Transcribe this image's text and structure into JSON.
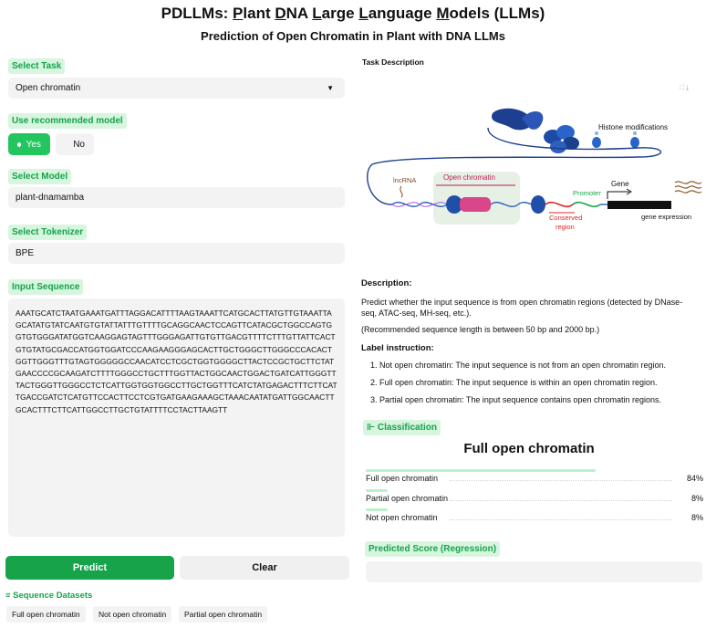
{
  "header": {
    "title_parts": [
      {
        "t": "PDLLMs: ",
        "u": false
      },
      {
        "t": "P",
        "u": true
      },
      {
        "t": "lant ",
        "u": false
      },
      {
        "t": "D",
        "u": true
      },
      {
        "t": "NA ",
        "u": false
      },
      {
        "t": "L",
        "u": true
      },
      {
        "t": "arge ",
        "u": false
      },
      {
        "t": "L",
        "u": true
      },
      {
        "t": "anguage ",
        "u": false
      },
      {
        "t": "M",
        "u": true
      },
      {
        "t": "odels (LLMs)",
        "u": false
      }
    ],
    "subtitle": "Prediction of Open Chromatin in Plant with DNA LLMs"
  },
  "left": {
    "task_label": "Select Task",
    "task_value": "Open chromatin",
    "recommended_label": "Use recommended model",
    "yes_label": "Yes",
    "no_label": "No",
    "model_label": "Select Model",
    "model_value": "plant-dnamamba",
    "tokenizer_label": "Select Tokenizer",
    "tokenizer_value": "BPE",
    "input_label": "Input Sequence",
    "sequence": "AAATGCATCTAATGAAATGATTTAGGACATTTTAAGTAAATTCATGCACTTATGTTGTAAATTAGCATATGTATCAATGTGTATTATTTGTTTTGCAGGCAACTCCAGTTCATACGCTGGCCAGTGGTGTGGGATATGGTCAAGGAGTAGTTTGGGAGATTGTGTTGACGTTTTCTTTGTTATTCACTGTGTATGCGACCATGGTGGATCCCAAGAAGGGAGCACTTGCTGGGCTTGGGCCCACACTGGTTGGGTTTGTAGTGGGGGCCAACATCCTCGCTGGTGGGGCTTACTCCGCTGCTTCTATGAACCCCGCAAGATCTTTTGGGCCTGCTTTGGTTACTGGCAACTGGACTGATCATTGGGTTTACTGGGTTGGGCCTCTCATTGGTGGTGGCCTTGCTGGTTTCATCTATGAGACTTTCTTCATTGACCGATCTCATGTTCCACTTCCTCGTGATGAAGAAAGCTAAACAATATGATTGGCAACTTGCACTTTCTTCATTGGCCTTGCTGTATTTTCCTACTTAAGTT",
    "predict_label": "Predict",
    "clear_label": "Clear",
    "datasets_title": "≡ Sequence Datasets",
    "datasets": [
      "Full open chromatin",
      "Not open chromatin",
      "Partial open chromatin"
    ]
  },
  "right": {
    "task_desc_label": "Task Description",
    "figure": {
      "histone": "Histone modifications",
      "lncrna": "lncRNA",
      "open_chromatin": "Open chromatin",
      "gene": "Gene",
      "promoter": "Promoter",
      "conserved": "Conserved",
      "region": "region",
      "expression": "gene expression"
    },
    "description_head": "Description:",
    "description_text": "Predict whether the input sequence is from open chromatin regions (detected by DNase-seq, ATAC-seq, MH-seq, etc.).",
    "range_text": "(Recommended sequence length is between 50 bp and 2000 bp.)",
    "label_head": "Label instruction:",
    "instructions": [
      "1. Not open chromatin: The input sequence is not from an open chromatin region.",
      "2. Full open chromatin: The input sequence is within an open chromatin region.",
      "3. Partial open chromatin: The input sequence contains open chromatin regions."
    ],
    "classification_label": "Classification",
    "classification_result": "Full open chromatin",
    "confidences": [
      {
        "label": "Full open chromatin",
        "value": "84%",
        "fraction": 0.84
      },
      {
        "label": "Partial open chromatin",
        "value": "8%",
        "fraction": 0.08
      },
      {
        "label": "Not open chromatin",
        "value": "8%",
        "fraction": 0.08
      }
    ],
    "regression_label": "Predicted Score (Regression)"
  },
  "colors": {
    "accent": "#16a34a",
    "chip_bg": "#d7f5df",
    "field_bg": "#f3f3f3"
  }
}
